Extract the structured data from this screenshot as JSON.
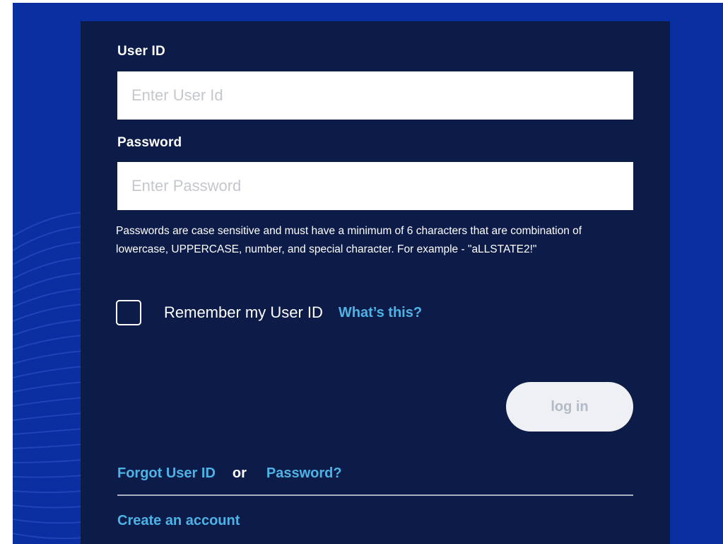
{
  "login": {
    "user_id_label": "User ID",
    "user_id_placeholder": "Enter User Id",
    "user_id_value": "",
    "password_label": "Password",
    "password_placeholder": "Enter Password",
    "password_value": "",
    "password_help": "Passwords are case sensitive and must have a minimum of 6 characters that are combination of lowercase, UPPERCASE, number, and special character. For example - \"aLLSTATE2!\"",
    "remember_label": "Remember my User ID",
    "remember_checked": false,
    "whats_this_label": "What’s this?",
    "login_button_label": "log in",
    "forgot_user_id_label": "Forgot User ID",
    "or_label": "or",
    "forgot_password_label": "Password?",
    "create_account_label": "Create an account"
  },
  "colors": {
    "background_blue": "#0a2fa0",
    "panel_navy": "#0c1b47",
    "link_blue": "#4db3e6",
    "button_disabled_bg": "#eef0f4",
    "button_disabled_text": "#b4bac6"
  },
  "icons": {
    "background_pattern": "concentric-arc-lines"
  }
}
